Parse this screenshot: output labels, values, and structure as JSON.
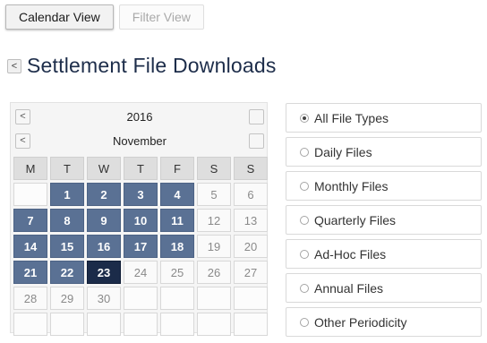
{
  "tabs": {
    "calendar_view": "Calendar View",
    "filter_view": "Filter View"
  },
  "page": {
    "title": "Settlement File Downloads",
    "back_glyph": "<"
  },
  "calendar": {
    "year": "2016",
    "month": "November",
    "prev_glyph": "<",
    "next_glyph": "",
    "weekdays": [
      "M",
      "T",
      "W",
      "T",
      "F",
      "S",
      "S"
    ],
    "leading_empty": 1,
    "days": [
      {
        "d": "1",
        "state": "avail"
      },
      {
        "d": "2",
        "state": "avail"
      },
      {
        "d": "3",
        "state": "avail"
      },
      {
        "d": "4",
        "state": "avail"
      },
      {
        "d": "5",
        "state": "plain"
      },
      {
        "d": "6",
        "state": "plain"
      },
      {
        "d": "7",
        "state": "avail"
      },
      {
        "d": "8",
        "state": "avail"
      },
      {
        "d": "9",
        "state": "avail"
      },
      {
        "d": "10",
        "state": "avail"
      },
      {
        "d": "11",
        "state": "avail"
      },
      {
        "d": "12",
        "state": "plain"
      },
      {
        "d": "13",
        "state": "plain"
      },
      {
        "d": "14",
        "state": "avail"
      },
      {
        "d": "15",
        "state": "avail"
      },
      {
        "d": "16",
        "state": "avail"
      },
      {
        "d": "17",
        "state": "avail"
      },
      {
        "d": "18",
        "state": "avail"
      },
      {
        "d": "19",
        "state": "plain"
      },
      {
        "d": "20",
        "state": "plain"
      },
      {
        "d": "21",
        "state": "avail"
      },
      {
        "d": "22",
        "state": "avail"
      },
      {
        "d": "23",
        "state": "selected"
      },
      {
        "d": "24",
        "state": "plain"
      },
      {
        "d": "25",
        "state": "plain"
      },
      {
        "d": "26",
        "state": "plain"
      },
      {
        "d": "27",
        "state": "plain"
      },
      {
        "d": "28",
        "state": "plain"
      },
      {
        "d": "29",
        "state": "plain"
      },
      {
        "d": "30",
        "state": "plain"
      }
    ],
    "total_cells": 42
  },
  "filters": {
    "options": [
      {
        "label": "All File Types",
        "checked": true
      },
      {
        "label": "Daily Files",
        "checked": false
      },
      {
        "label": "Monthly Files",
        "checked": false
      },
      {
        "label": "Quarterly Files",
        "checked": false
      },
      {
        "label": "Ad-Hoc Files",
        "checked": false
      },
      {
        "label": "Annual Files",
        "checked": false
      },
      {
        "label": "Other Periodicity",
        "checked": false
      }
    ]
  },
  "colors": {
    "available_day": "#5a7194",
    "selected_day": "#1b2b49",
    "title_text": "#1d2d4a"
  },
  "icons": {
    "back": "chevron-left-icon",
    "prev_year": "chevron-left-icon",
    "prev_month": "chevron-left-icon"
  }
}
